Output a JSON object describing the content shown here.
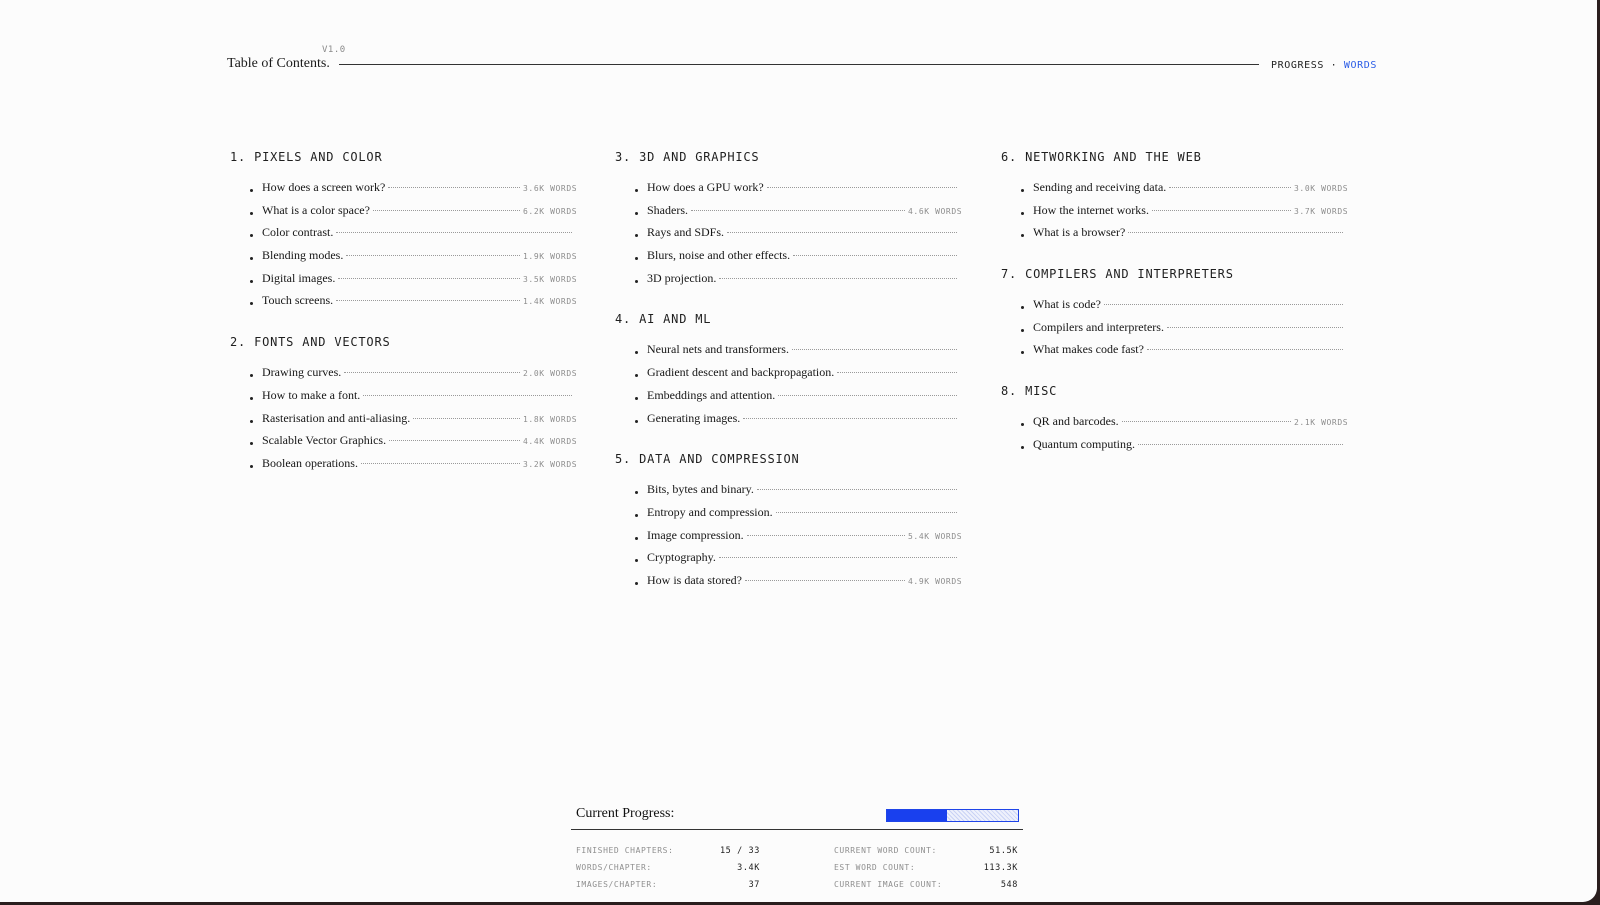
{
  "header": {
    "version": "V1.0",
    "title": "Table of Contents.",
    "mode_label": "PROGRESS",
    "mode_separator": "·",
    "mode_active": "WORDS",
    "accent_color": "#2a5ce6"
  },
  "chapters": [
    {
      "title": "1. PIXELS AND COLOR",
      "items": [
        {
          "title": "How does a screen work?",
          "words": "3.6K WORDS"
        },
        {
          "title": "What is a color space?",
          "words": "6.2K WORDS"
        },
        {
          "title": "Color contrast.",
          "words": ""
        },
        {
          "title": "Blending modes.",
          "words": "1.9K WORDS"
        },
        {
          "title": "Digital images.",
          "words": "3.5K WORDS"
        },
        {
          "title": "Touch screens.",
          "words": "1.4K WORDS"
        }
      ]
    },
    {
      "title": "2. FONTS AND VECTORS",
      "items": [
        {
          "title": "Drawing curves.",
          "words": "2.0K WORDS"
        },
        {
          "title": "How to make a font.",
          "words": ""
        },
        {
          "title": "Rasterisation and anti-aliasing.",
          "words": "1.8K WORDS"
        },
        {
          "title": "Scalable Vector Graphics.",
          "words": "4.4K WORDS"
        },
        {
          "title": "Boolean operations.",
          "words": "3.2K WORDS"
        }
      ]
    },
    {
      "title": "3. 3D AND GRAPHICS",
      "items": [
        {
          "title": "How does a GPU work?",
          "words": ""
        },
        {
          "title": "Shaders.",
          "words": "4.6K WORDS"
        },
        {
          "title": "Rays and SDFs.",
          "words": ""
        },
        {
          "title": "Blurs, noise and other effects.",
          "words": ""
        },
        {
          "title": "3D projection.",
          "words": ""
        }
      ]
    },
    {
      "title": "4. AI AND ML",
      "items": [
        {
          "title": "Neural nets and transformers.",
          "words": ""
        },
        {
          "title": "Gradient descent and backpropagation.",
          "words": ""
        },
        {
          "title": "Embeddings and attention.",
          "words": ""
        },
        {
          "title": "Generating images.",
          "words": ""
        }
      ]
    },
    {
      "title": "5. DATA AND COMPRESSION",
      "items": [
        {
          "title": "Bits, bytes and binary.",
          "words": ""
        },
        {
          "title": "Entropy and compression.",
          "words": ""
        },
        {
          "title": "Image compression.",
          "words": "5.4K WORDS"
        },
        {
          "title": "Cryptography.",
          "words": ""
        },
        {
          "title": "How is data stored?",
          "words": "4.9K WORDS"
        }
      ]
    },
    {
      "title": "6. NETWORKING AND THE WEB",
      "items": [
        {
          "title": "Sending and receiving data.",
          "words": "3.0K WORDS"
        },
        {
          "title": "How the internet works.",
          "words": "3.7K WORDS"
        },
        {
          "title": "What is a browser?",
          "words": ""
        }
      ]
    },
    {
      "title": "7. COMPILERS AND INTERPRETERS",
      "items": [
        {
          "title": "What is code?",
          "words": ""
        },
        {
          "title": "Compilers and interpreters.",
          "words": ""
        },
        {
          "title": "What makes code fast?",
          "words": ""
        }
      ]
    },
    {
      "title": "8. MISC",
      "items": [
        {
          "title": "QR and barcodes.",
          "words": "2.1K WORDS"
        },
        {
          "title": "Quantum computing.",
          "words": ""
        }
      ]
    }
  ],
  "columns": [
    [
      0,
      1
    ],
    [
      2,
      3,
      4
    ],
    [
      5,
      6,
      7
    ]
  ],
  "progress": {
    "label": "Current Progress:",
    "fraction": 0.4545,
    "bar_color": "#1940ee",
    "stats": [
      {
        "key": "FINISHED CHAPTERS:",
        "value": "15 / 33"
      },
      {
        "key": "WORDS/CHAPTER:",
        "value": "3.4K"
      },
      {
        "key": "IMAGES/CHAPTER:",
        "value": "37"
      },
      {
        "key": "CURRENT WORD COUNT:",
        "value": "51.5K"
      },
      {
        "key": "EST WORD COUNT:",
        "value": "113.3K"
      },
      {
        "key": "CURRENT IMAGE COUNT:",
        "value": "548"
      }
    ]
  }
}
